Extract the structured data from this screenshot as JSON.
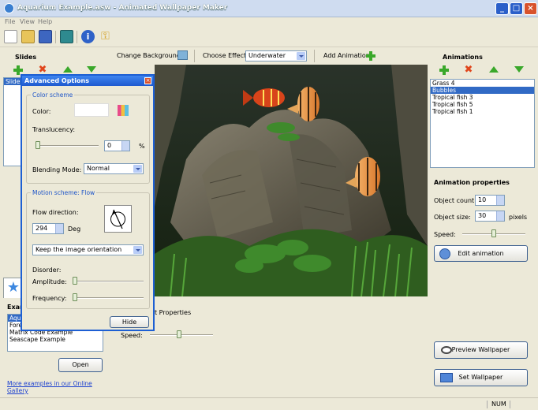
{
  "window": {
    "title": "Aquarium Example.asw - Animated Wallpaper Maker"
  },
  "menu": [
    "File",
    "View",
    "Help"
  ],
  "toolbar": {
    "change_background": "Change Background",
    "choose_effect": "Choose Effect:",
    "effect_value": "Underwater",
    "add_animation": "Add Animation"
  },
  "slides": {
    "title": "Slides",
    "items": [
      "Slide"
    ]
  },
  "examples": {
    "title": "Exam",
    "items": [
      "Aqua",
      "Fore",
      "Matrix Code Example",
      "Seascape Example"
    ],
    "selected_index": 0,
    "open_label": "Open",
    "gallery_link": "More examples in our Online Gallery"
  },
  "dialog": {
    "title": "Advanced Options",
    "color_scheme": "Color scheme",
    "color_label": "Color:",
    "translucency_label": "Translucency:",
    "translucency_value": "0",
    "translucency_unit": "%",
    "blending_label": "Blending Mode:",
    "blending_value": "Normal",
    "motion_scheme": "Motion scheme: Flow",
    "flow_direction_label": "Flow direction:",
    "flow_direction_value": "294",
    "flow_direction_unit": "Deg",
    "orientation_value": "Keep the image orientation",
    "disorder_label": "Disorder:",
    "amplitude_label": "Amplitude:",
    "frequency_label": "Frequency:",
    "hide_label": "Hide"
  },
  "slide_props": {
    "title_fragment": "t Properties",
    "speed_label": "Speed:"
  },
  "animations": {
    "title": "Animations",
    "items": [
      "Grass 4",
      "Bubbles",
      "Tropical fish 3",
      "Tropical fish 5",
      "Tropical fish 1"
    ],
    "selected_index": 1
  },
  "anim_props": {
    "title": "Animation properties",
    "object_count_label": "Object count:",
    "object_count_value": "10",
    "object_size_label": "Object size:",
    "object_size_value": "30",
    "object_size_unit": "pixels",
    "speed_label": "Speed:",
    "edit_label": "Edit animation"
  },
  "actions": {
    "preview_label": "Preview Wallpaper",
    "set_label": "Set Wallpaper"
  },
  "status": {
    "num": "NUM"
  },
  "colors": {
    "accent": "#316ac5",
    "dialog_border": "#1d5fd3",
    "add_green": "#3aa82a",
    "remove_red": "#e0461c"
  }
}
